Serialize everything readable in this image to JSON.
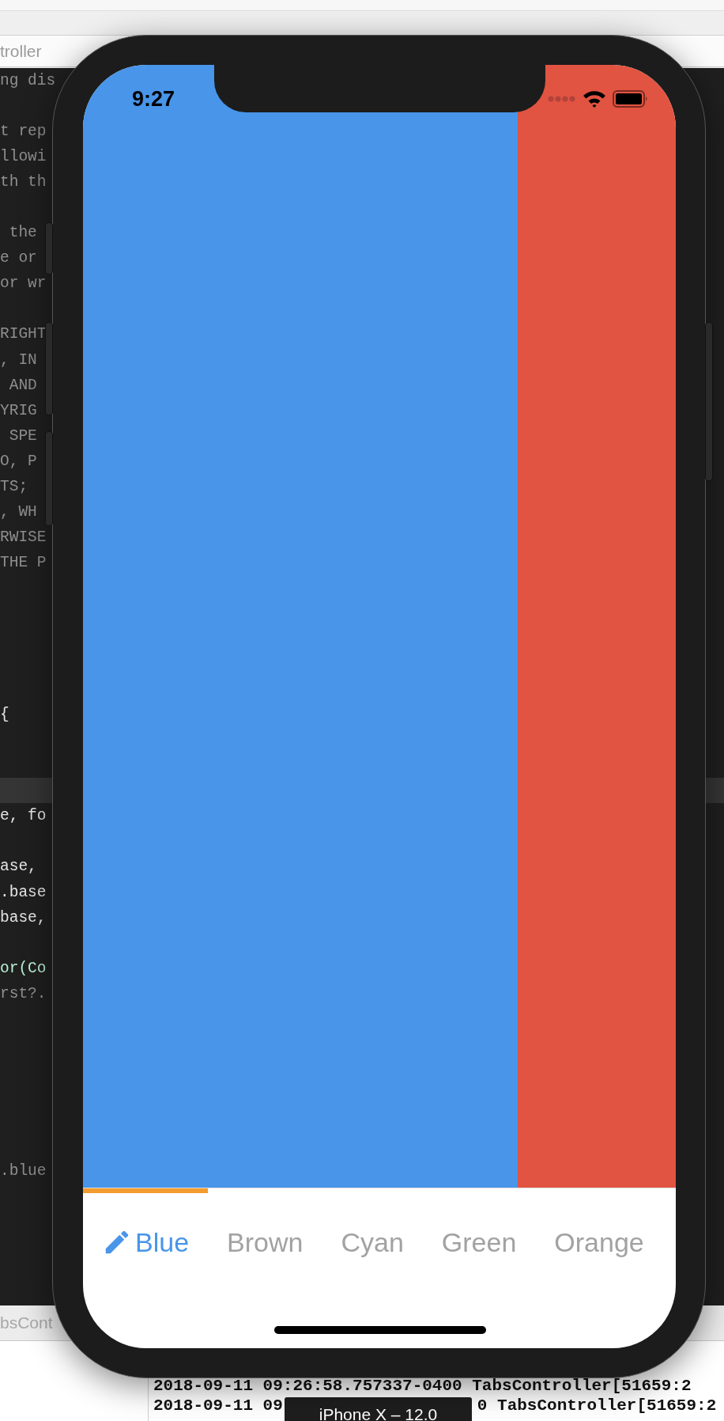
{
  "breadcrumb": {
    "items": [
      "troller"
    ]
  },
  "code_lines": [
    {
      "kind": "comment",
      "text": "ng dis"
    },
    {
      "kind": "blank"
    },
    {
      "kind": "comment",
      "text": "t rep"
    },
    {
      "kind": "comment",
      "text": "llowi"
    },
    {
      "kind": "comment",
      "text": "th th"
    },
    {
      "kind": "blank"
    },
    {
      "kind": "comment",
      "text": " the"
    },
    {
      "kind": "comment",
      "text": "e or"
    },
    {
      "kind": "comment",
      "text": "or wr"
    },
    {
      "kind": "blank"
    },
    {
      "kind": "comment",
      "text": "RIGHT"
    },
    {
      "kind": "comment",
      "text": ", IN"
    },
    {
      "kind": "comment",
      "text": " AND"
    },
    {
      "kind": "comment",
      "text": "YRIG"
    },
    {
      "kind": "comment",
      "text": " SPE"
    },
    {
      "kind": "comment",
      "text": "O, P"
    },
    {
      "kind": "comment",
      "text": "TS; "
    },
    {
      "kind": "comment",
      "text": ", WH"
    },
    {
      "kind": "comment",
      "text": "RWISE"
    },
    {
      "kind": "comment",
      "text": "THE P"
    },
    {
      "kind": "blank"
    },
    {
      "kind": "blank"
    },
    {
      "kind": "blank"
    },
    {
      "kind": "blank"
    },
    {
      "kind": "blank"
    },
    {
      "kind": "code",
      "text": "{"
    },
    {
      "kind": "blank"
    },
    {
      "kind": "blank"
    },
    {
      "kind": "current"
    },
    {
      "kind": "code",
      "text": "e, fo"
    },
    {
      "kind": "blank"
    },
    {
      "kind": "code",
      "text": "ase,"
    },
    {
      "kind": "code",
      "text": ".base"
    },
    {
      "kind": "code",
      "text": "base,"
    },
    {
      "kind": "blank"
    },
    {
      "kind": "call",
      "text": "or(Co"
    },
    {
      "kind": "comment",
      "text": "rst?."
    },
    {
      "kind": "blank"
    },
    {
      "kind": "blank"
    },
    {
      "kind": "blank"
    },
    {
      "kind": "blank"
    },
    {
      "kind": "blank"
    },
    {
      "kind": "blank"
    },
    {
      "kind": "comment",
      "text": ".blue"
    }
  ],
  "lower_bar": {
    "text": "bsCont"
  },
  "console": {
    "lines": [
      {
        "parts": [
          "2018-09-11 09:26:58.757337-0400 TabsController[51659:2"
        ]
      },
      {
        "parts": [
          "2018-09-11 09",
          "0 TabsController[51659:2"
        ]
      }
    ]
  },
  "tooltip": {
    "text": "iPhone X – 12.0"
  },
  "phone": {
    "status_bar": {
      "time": "9:27"
    },
    "pages": [
      {
        "color": "#4895e9"
      },
      {
        "color": "#e15441"
      }
    ],
    "tabs": [
      {
        "label": "Blue",
        "selected": true,
        "kind": "icon_label"
      },
      {
        "label": "Brown",
        "selected": false
      },
      {
        "label": "Cyan",
        "selected": false
      },
      {
        "label": "Green",
        "selected": false
      },
      {
        "label": "Orange",
        "selected": false
      }
    ]
  }
}
